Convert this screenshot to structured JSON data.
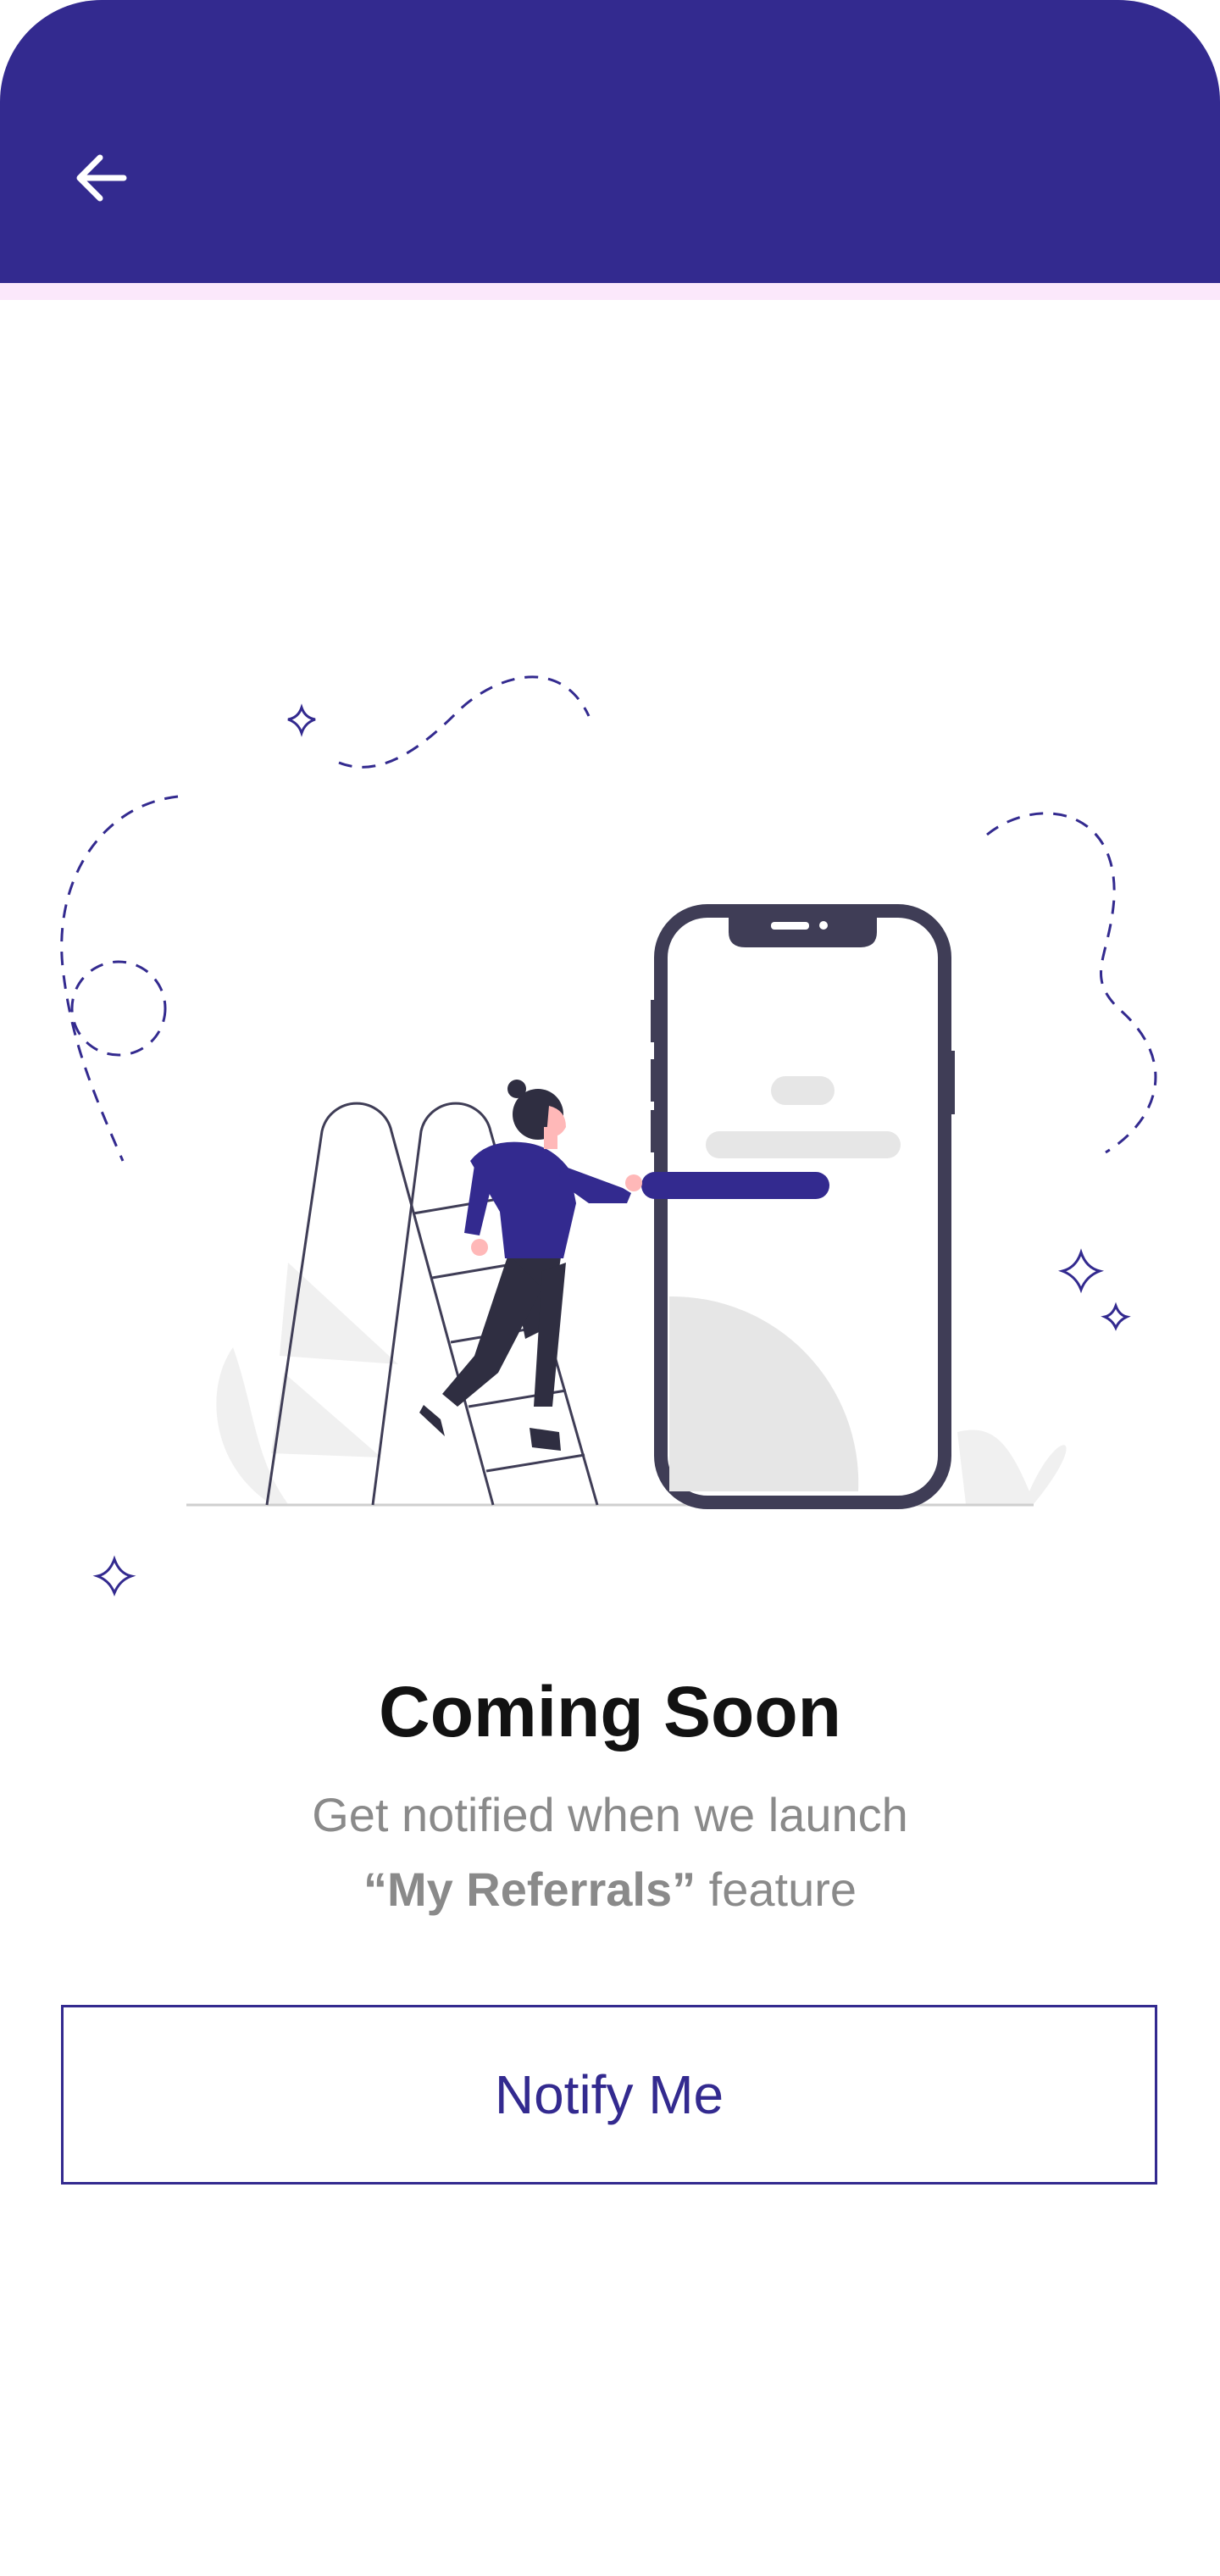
{
  "header": {
    "back_icon": "arrow-left-icon",
    "background_color": "#332a8f",
    "strip_color": "#fbe8fb"
  },
  "illustration": {
    "name": "coming-soon-illustration",
    "accent_color": "#332a8f",
    "phone_frame_color": "#3f3d56"
  },
  "content": {
    "title": "Coming Soon",
    "subtitle_line1": "Get notified when we launch",
    "feature_name": "“My Referrals”",
    "subtitle_suffix": " feature"
  },
  "actions": {
    "notify_label": "Notify Me"
  }
}
